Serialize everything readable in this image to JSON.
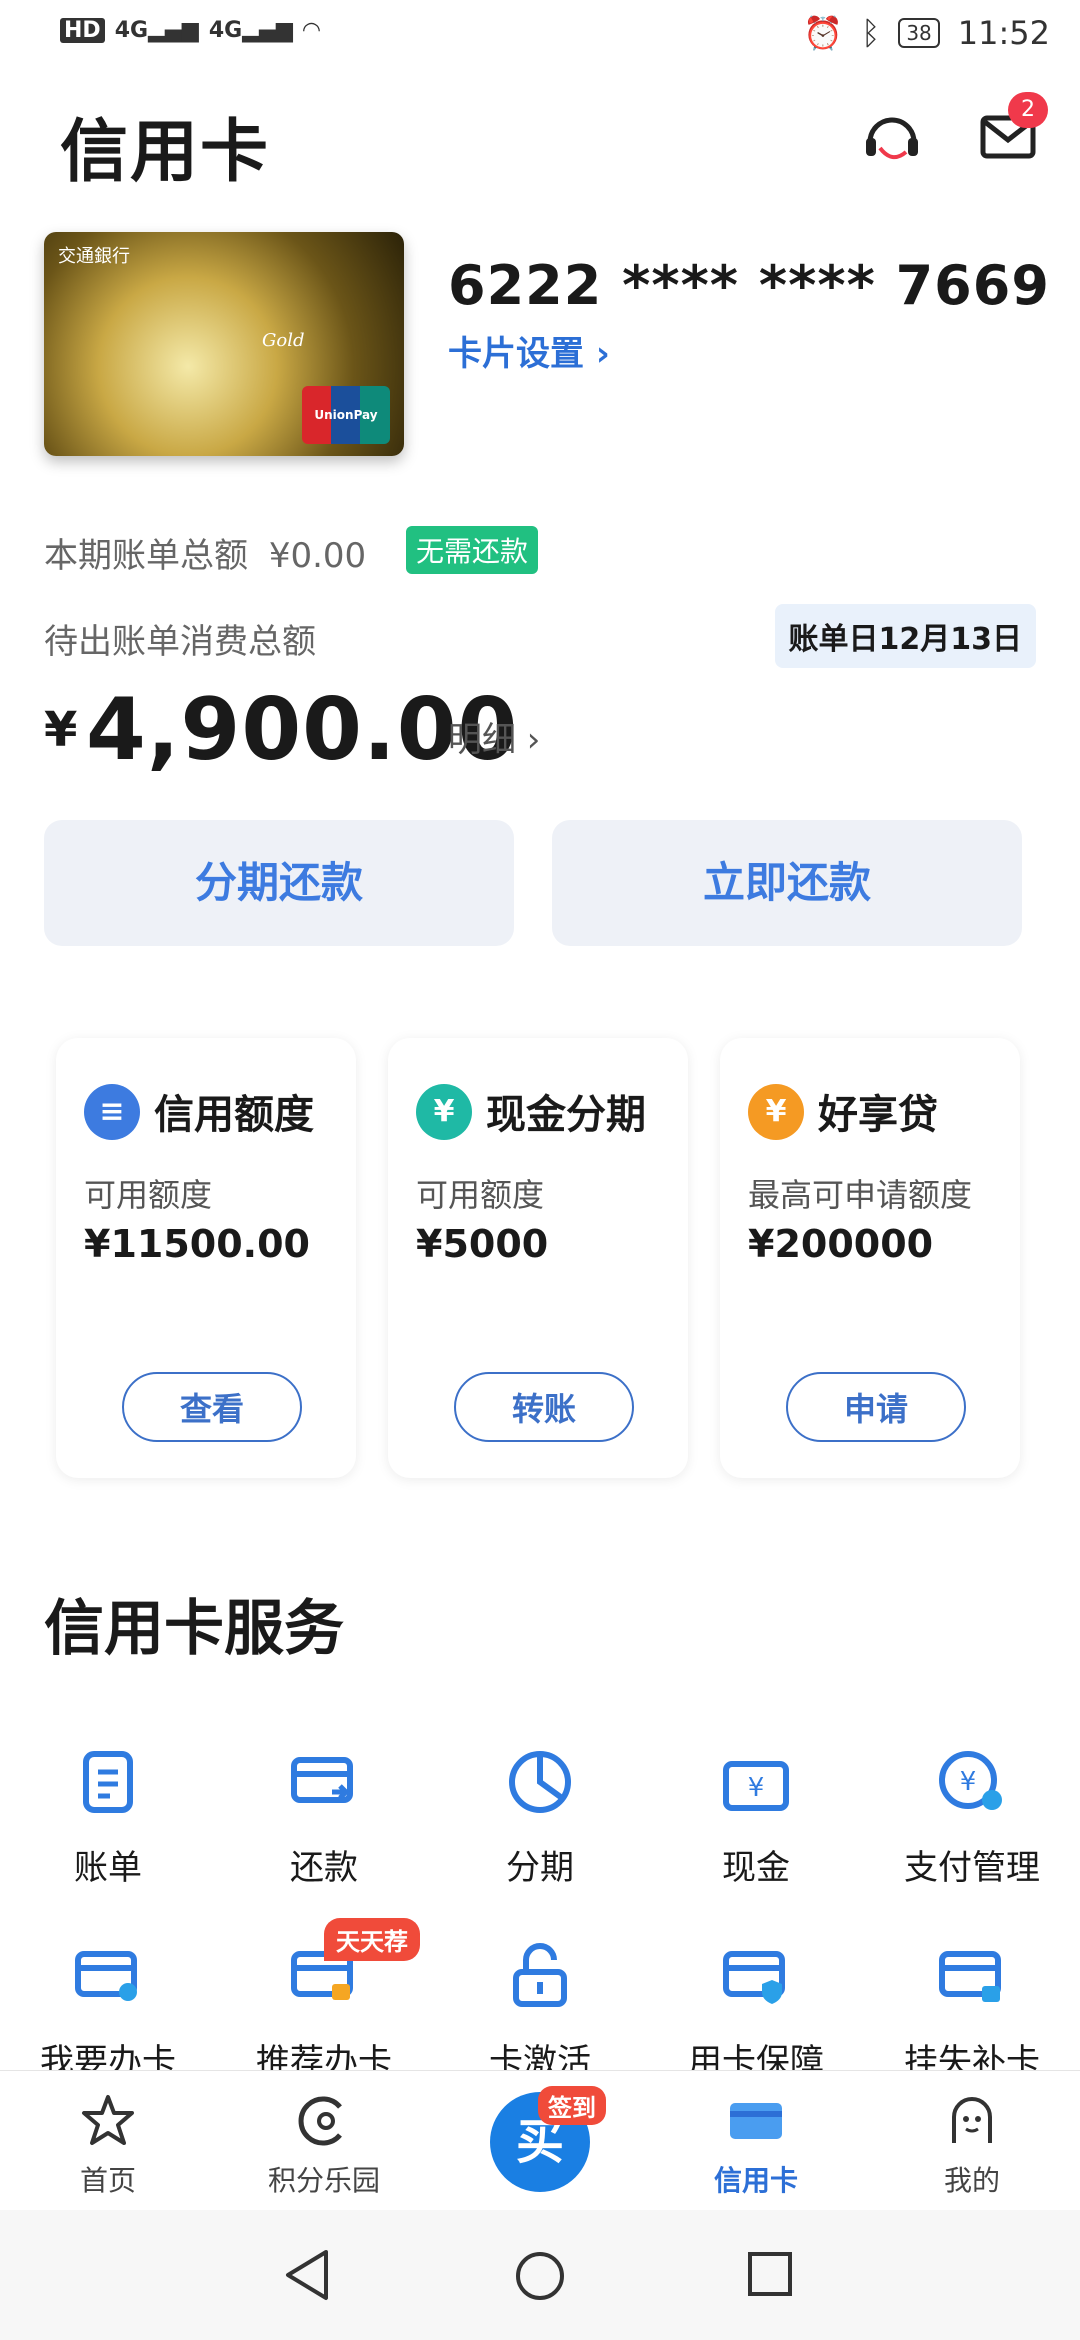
{
  "status_bar": {
    "left_text": "HD",
    "signal1": "4G",
    "signal2": "4G",
    "battery": "38",
    "time": "11:52"
  },
  "header": {
    "title": "信用卡",
    "message_count": "2"
  },
  "card": {
    "bank_name": "交通銀行",
    "type_label": "Gold",
    "number": "6222 **** **** 7669",
    "settings_label": "卡片设置 ›"
  },
  "bill": {
    "current_label": "本期账单总额",
    "current_amount": "¥0.00",
    "no_pay_badge": "无需还款",
    "pending_label": "待出账单消费总额",
    "bill_day": "账单日12月13日",
    "currency_symbol": "¥",
    "pending_amount": "4,900.00",
    "detail_label": "明细 ›"
  },
  "actions": {
    "installment_repay": "分期还款",
    "repay_now": "立即还款"
  },
  "tiles": [
    {
      "icon": "coins-icon",
      "color": "#3d7be0",
      "title": "信用额度",
      "sub": "可用额度",
      "value": "¥11500.00",
      "button": "查看"
    },
    {
      "icon": "yen-icon",
      "color": "#1fb9a5",
      "title": "现金分期",
      "sub": "可用额度",
      "value": "¥5000",
      "button": "转账"
    },
    {
      "icon": "money-bag-icon",
      "color": "#f59a23",
      "title": "好享贷",
      "sub": "最高可申请额度",
      "value": "¥200000",
      "button": "申请"
    }
  ],
  "services": {
    "title": "信用卡服务",
    "row1": [
      "账单",
      "还款",
      "分期",
      "现金",
      "支付管理"
    ],
    "row2": [
      "我要办卡",
      "推荐办卡",
      "卡激活",
      "用卡保障",
      "挂失补卡"
    ],
    "recommend_tag": "天天荐"
  },
  "bottom_nav": {
    "items": [
      "首页",
      "积分乐园",
      "",
      "信用卡",
      "我的"
    ],
    "center_tag": "签到",
    "center_glyph": "买"
  }
}
